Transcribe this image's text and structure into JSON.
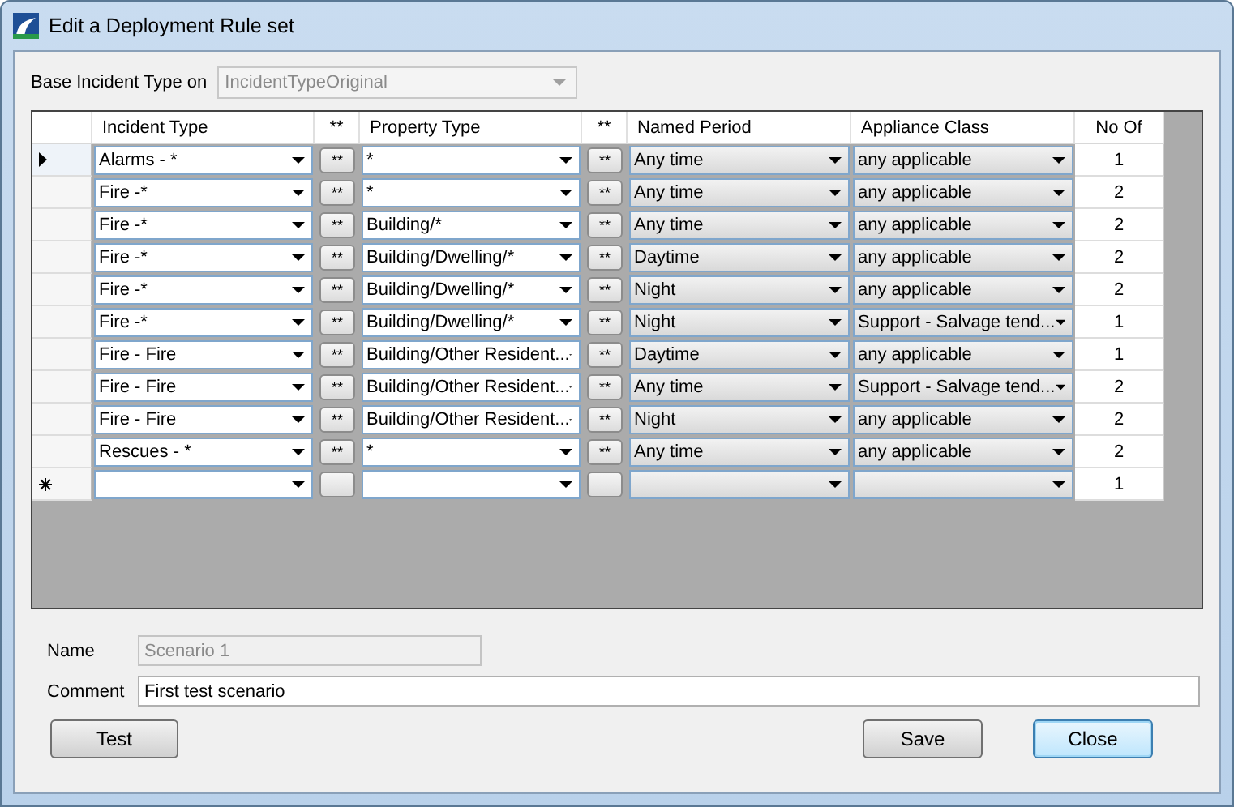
{
  "window": {
    "title": "Edit a Deployment Rule set"
  },
  "base_incident_type": {
    "label": "Base Incident Type on",
    "value": "IncidentTypeOriginal",
    "disabled": true
  },
  "grid": {
    "columns": [
      "Incident Type",
      "**",
      "Property Type",
      "**",
      "Named Period",
      "Appliance Class",
      "No Of"
    ],
    "rows": [
      {
        "kind": "data",
        "selected": true,
        "incident_type": "Alarms - *",
        "button": "**",
        "property_type": "*",
        "button_2": "**",
        "named_period": "Any time",
        "appliance_class": "any applicable",
        "no_of": "1"
      },
      {
        "kind": "data",
        "selected": false,
        "incident_type": "Fire -*",
        "button": "**",
        "property_type": "*",
        "button_2": "**",
        "named_period": "Any time",
        "appliance_class": "any applicable",
        "no_of": "2"
      },
      {
        "kind": "data",
        "selected": false,
        "incident_type": "Fire -*",
        "button": "**",
        "property_type": "Building/*",
        "button_2": "**",
        "named_period": "Any time",
        "appliance_class": "any applicable",
        "no_of": "2"
      },
      {
        "kind": "data",
        "selected": false,
        "incident_type": "Fire -*",
        "button": "**",
        "property_type": "Building/Dwelling/*",
        "button_2": "**",
        "named_period": "Daytime",
        "appliance_class": "any applicable",
        "no_of": "2"
      },
      {
        "kind": "data",
        "selected": false,
        "incident_type": "Fire -*",
        "button": "**",
        "property_type": "Building/Dwelling/*",
        "button_2": "**",
        "named_period": "Night",
        "appliance_class": "any applicable",
        "no_of": "2"
      },
      {
        "kind": "data",
        "selected": false,
        "incident_type": "Fire -*",
        "button": "**",
        "property_type": "Building/Dwelling/*",
        "button_2": "**",
        "named_period": "Night",
        "appliance_class": "Support - Salvage tend...",
        "no_of": "1"
      },
      {
        "kind": "data",
        "selected": false,
        "incident_type": "Fire - Fire",
        "button": "**",
        "property_type": "Building/Other Resident...",
        "button_2": "**",
        "named_period": "Daytime",
        "appliance_class": "any applicable",
        "no_of": "1"
      },
      {
        "kind": "data",
        "selected": false,
        "incident_type": "Fire - Fire",
        "button": "**",
        "property_type": "Building/Other Resident...",
        "button_2": "**",
        "named_period": "Any time",
        "appliance_class": "Support - Salvage tend...",
        "no_of": "2"
      },
      {
        "kind": "data",
        "selected": false,
        "incident_type": "Fire - Fire",
        "button": "**",
        "property_type": "Building/Other Resident...",
        "button_2": "**",
        "named_period": "Night",
        "appliance_class": "any applicable",
        "no_of": "2"
      },
      {
        "kind": "data",
        "selected": false,
        "incident_type": "Rescues - *",
        "button": "**",
        "property_type": "*",
        "button_2": "**",
        "named_period": "Any time",
        "appliance_class": "any applicable",
        "no_of": "2"
      },
      {
        "kind": "new",
        "selected": false,
        "no_of": "1"
      }
    ]
  },
  "name": {
    "label": "Name",
    "value": "Scenario 1",
    "disabled": true
  },
  "comment": {
    "label": "Comment",
    "value": "First test scenario",
    "disabled": false
  },
  "buttons": [
    {
      "label": "Test",
      "focused": false
    },
    {
      "label": "Save",
      "focused": false
    },
    {
      "label": "Close",
      "focused": true
    }
  ]
}
